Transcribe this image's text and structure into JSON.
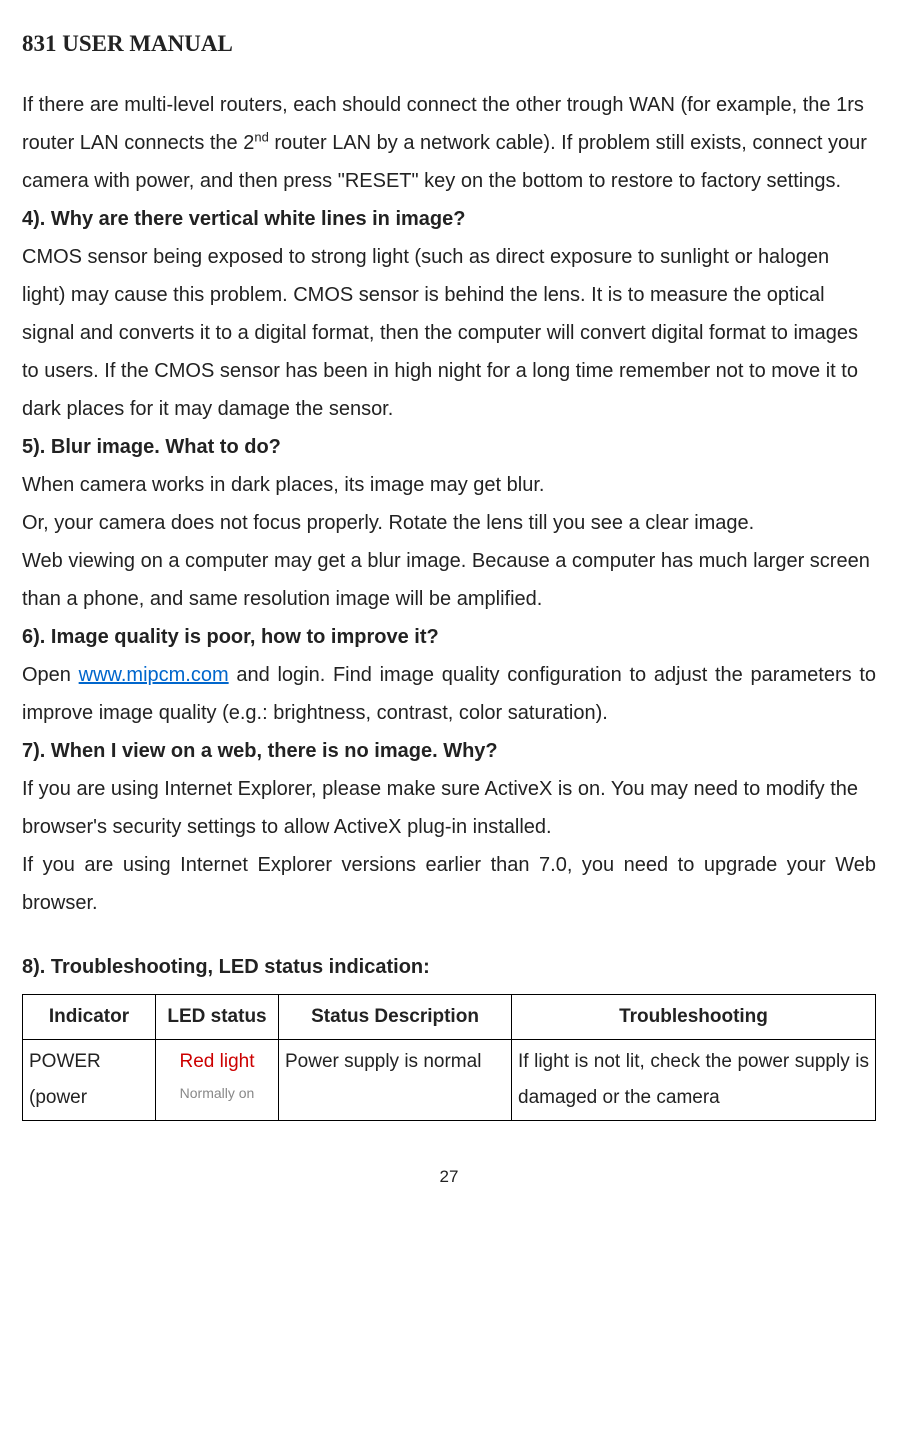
{
  "header": "831 USER MANUAL",
  "para1a": "If there are multi-level routers, each should connect the other trough WAN (for example, the 1rs router LAN connects the 2",
  "para1sup": "nd",
  "para1b": " router LAN by a network cable). If problem still exists, connect your camera with power, and then press \"RESET\" key on the bottom to restore to factory settings.",
  "q4": "4). Why are there vertical white lines in image?",
  "a4": "CMOS sensor being exposed to strong light (such as direct exposure to sunlight or halogen light) may cause this problem. CMOS sensor is behind the lens. It is to measure the optical signal and converts it to a digital format, then the computer will convert digital format to images to users. If the CMOS sensor has been in high night for a long time remember not to move it to dark places for it may damage the sensor.",
  "q5": "5). Blur image. What to do?",
  "a5a": "When camera works in dark places, its image may get blur.",
  "a5b": "Or, your camera does not focus properly. Rotate the lens till you see a clear image.",
  "a5c": "Web viewing on a computer may get a blur image. Because a computer has much larger screen than a phone, and same resolution image will be amplified.",
  "q6": "6). Image quality is poor, how to improve it?",
  "a6a": "Open ",
  "a6link": "www.mipcm.com",
  "a6b": " and login. Find image quality configuration to adjust the parameters to improve image quality (e.g.: brightness, contrast, color saturation).",
  "q7": "7). When I view on a web, there is no image. Why?",
  "a7a": "If you are using Internet Explorer, please make sure ActiveX is on.  You may need to modify the browser's security settings to allow ActiveX plug-in installed.",
  "a7b": "If you are using Internet Explorer versions earlier than 7.0, you need to upgrade your Web browser.",
  "q8": "8). Troubleshooting, LED status indication:",
  "table": {
    "headers": {
      "indicator": "Indicator",
      "led": "LED status",
      "status": "Status Description",
      "trouble": "Troubleshooting"
    },
    "row1": {
      "indicator": "POWER (power",
      "led_red": "Red light",
      "led_note": "Normally on",
      "status": "Power supply is normal",
      "trouble": "If light is not lit, check the power supply is damaged or the camera"
    }
  },
  "pageNumber": "27"
}
